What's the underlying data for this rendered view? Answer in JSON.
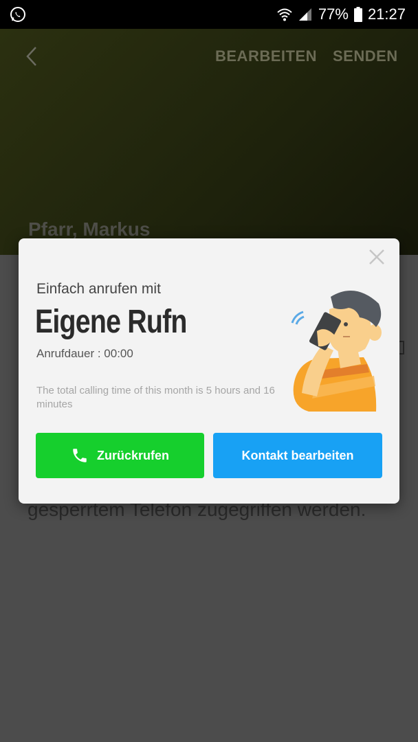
{
  "status_bar": {
    "app_icon": "whatsapp-icon",
    "battery": "77%",
    "time": "21:27"
  },
  "header": {
    "edit_label": "BEARBEITEN",
    "send_label": "SENDEN",
    "contact_name": "Pfarr, Markus"
  },
  "background": {
    "partial_text": "gesperrtem Telefon zugegriffen werden."
  },
  "dialog": {
    "subtitle": "Einfach anrufen mit",
    "title": "Eigene Rufn",
    "duration": "Anrufdauer : 00:00",
    "note": "The total calling time of this month is 5 hours and 16 minutes",
    "callback_label": "Zurückrufen",
    "edit_contact_label": "Kontakt bearbeiten"
  }
}
